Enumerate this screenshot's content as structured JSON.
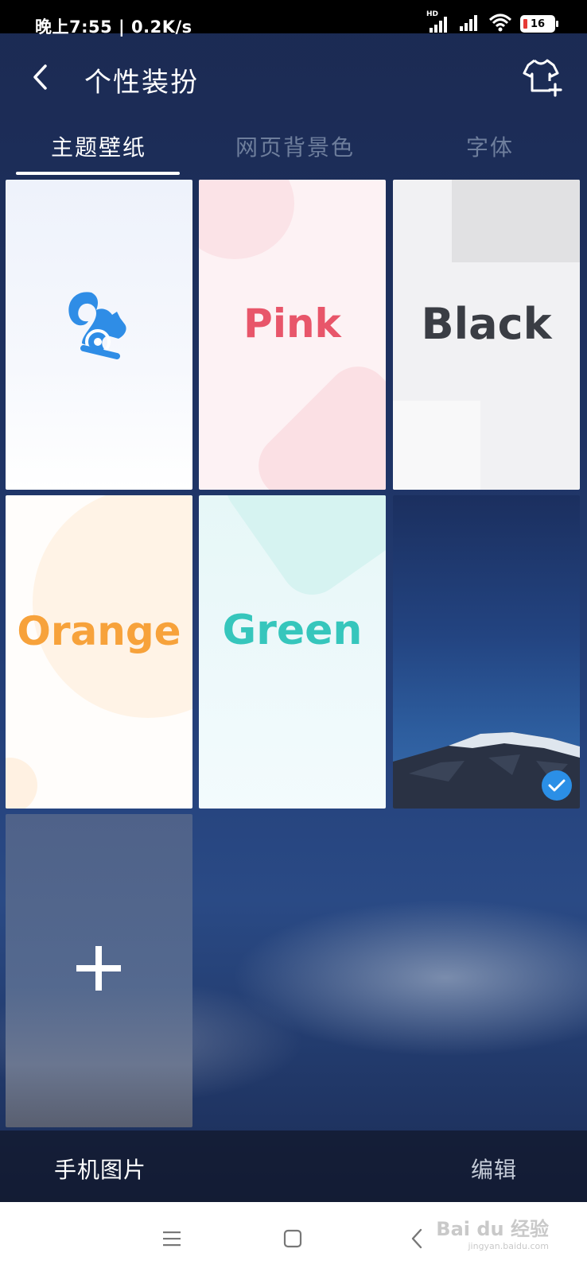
{
  "status_bar": {
    "time": "晚上7:55 | 0.2K/s",
    "battery_level": "16",
    "hd_label": "HD",
    "colors": {
      "battery_low": "#e53935"
    }
  },
  "header": {
    "title": "个性装扮",
    "back_icon": "chevron-left-icon",
    "action_icon": "tshirt-add-icon"
  },
  "tabs": [
    {
      "label": "主题壁纸",
      "active": true
    },
    {
      "label": "网页背景色",
      "active": false
    },
    {
      "label": "字体",
      "active": false
    }
  ],
  "themes": [
    {
      "name": "default-squirrel",
      "label": "",
      "icon": "uc-squirrel-logo"
    },
    {
      "name": "pink",
      "label": "Pink",
      "color": "#e8566a"
    },
    {
      "name": "black",
      "label": "Black",
      "color": "#3a3d44"
    },
    {
      "name": "orange",
      "label": "Orange",
      "color": "#f7a23b"
    },
    {
      "name": "green",
      "label": "Green",
      "color": "#36c6bc"
    },
    {
      "name": "mountain",
      "label": "",
      "selected": true
    },
    {
      "name": "add-custom",
      "label": "",
      "icon": "plus-icon"
    }
  ],
  "bottom_bar": {
    "left_label": "手机图片",
    "right_label": "编辑"
  },
  "nav_bar": {
    "icons": [
      "menu-icon",
      "home-square-icon",
      "back-chevron-icon"
    ]
  },
  "watermark": {
    "brand": "Bai du 经验",
    "url": "jingyan.baidu.com"
  },
  "accent_colors": {
    "selection": "#2b8fe6",
    "uc_blue": "#2f8de6"
  }
}
